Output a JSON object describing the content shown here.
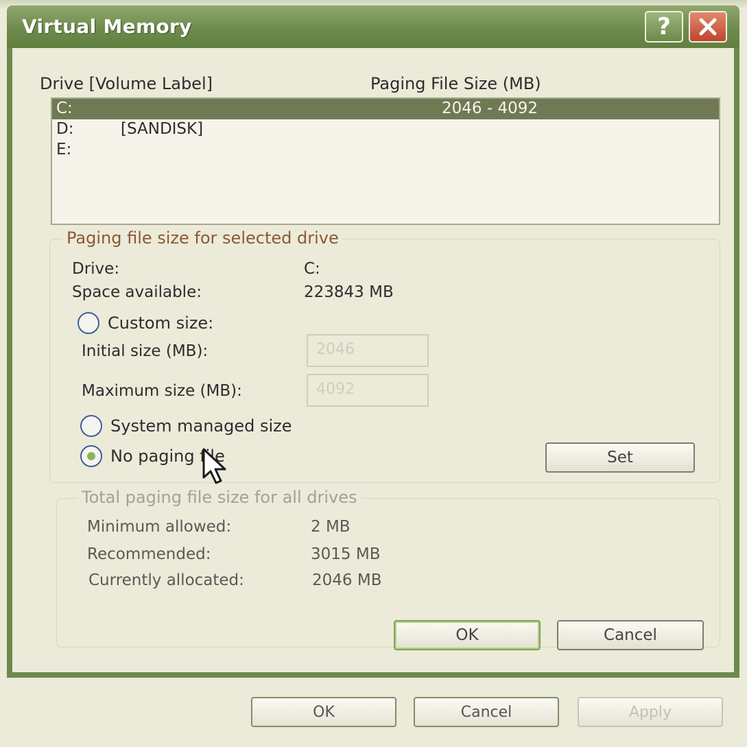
{
  "dialog": {
    "title": "Virtual Memory",
    "help_label": "?",
    "drive_header": "Drive  [Volume Label]",
    "size_header": "Paging File Size (MB)",
    "drives": [
      {
        "letter": "C:",
        "label": "",
        "size": "2046 - 4092",
        "selected": true
      },
      {
        "letter": "D:",
        "label": "[SANDISK]",
        "size": "",
        "selected": false
      },
      {
        "letter": "E:",
        "label": "",
        "size": "",
        "selected": false
      }
    ],
    "selected_group": {
      "title": "Paging file size for selected drive",
      "drive_label": "Drive:",
      "drive_value": "C:",
      "space_label": "Space available:",
      "space_value": "223843 MB",
      "custom_label": "Custom size:",
      "initial_label": "Initial size (MB):",
      "initial_value": "2046",
      "max_label": "Maximum size (MB):",
      "max_value": "4092",
      "system_label": "System managed size",
      "nopaging_label": "No paging file",
      "selected_option": "No paging file",
      "set_label": "Set"
    },
    "total_group": {
      "title": "Total paging file size for all drives",
      "min_label": "Minimum allowed:",
      "min_value": "2 MB",
      "rec_label": "Recommended:",
      "rec_value": "3015 MB",
      "alloc_label": "Currently allocated:",
      "alloc_value": "2046 MB"
    },
    "ok_label": "OK",
    "cancel_label": "Cancel"
  },
  "parent": {
    "ok_label": "OK",
    "cancel_label": "Cancel",
    "apply_label": "Apply"
  },
  "colors": {
    "titlebar": "#6e8b4d",
    "selection": "#6f7a55",
    "group_title": "#8a5a33",
    "close_button": "#c0442d"
  }
}
